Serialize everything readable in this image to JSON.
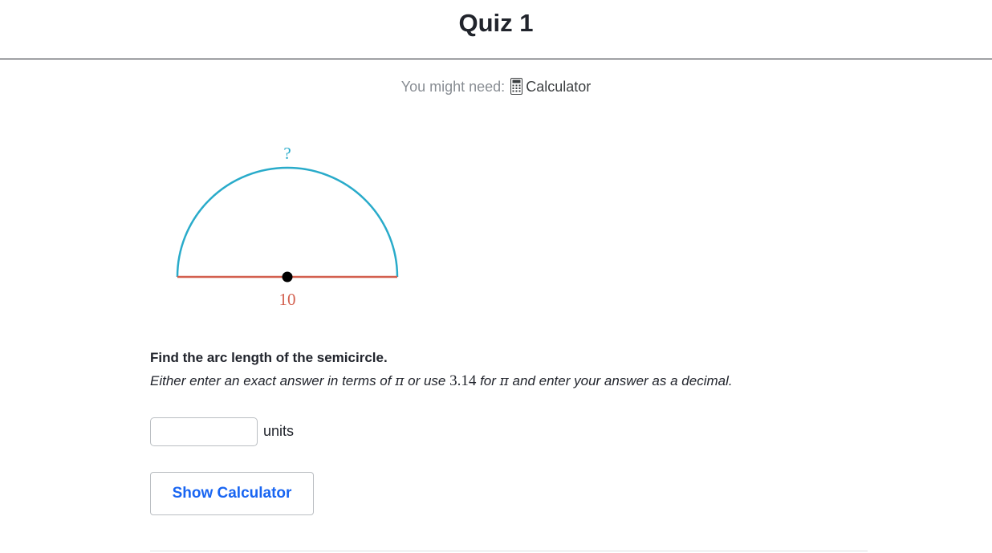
{
  "header": {
    "title": "Quiz 1"
  },
  "tools": {
    "prefix": "You might need:",
    "icon": "calculator-icon",
    "tool_name": "Calculator"
  },
  "figure": {
    "arc_label": "?",
    "diameter_label": "10",
    "arc_color": "#29abca",
    "diameter_color": "#d3604f",
    "center_color": "#000000"
  },
  "question": {
    "title": "Find the arc length of the semicircle.",
    "instruction_part1": "Either enter an exact answer in terms of ",
    "pi": "π",
    "instruction_part2": " or use ",
    "approx": "3.14",
    "instruction_part3": " for ",
    "instruction_part4": " and enter your answer as a decimal."
  },
  "answer": {
    "value": "",
    "placeholder": "",
    "units": "units"
  },
  "actions": {
    "show_calculator_label": "Show Calculator"
  },
  "colors": {
    "accent": "#1865f2",
    "text": "#21242c",
    "muted": "#888d93"
  }
}
